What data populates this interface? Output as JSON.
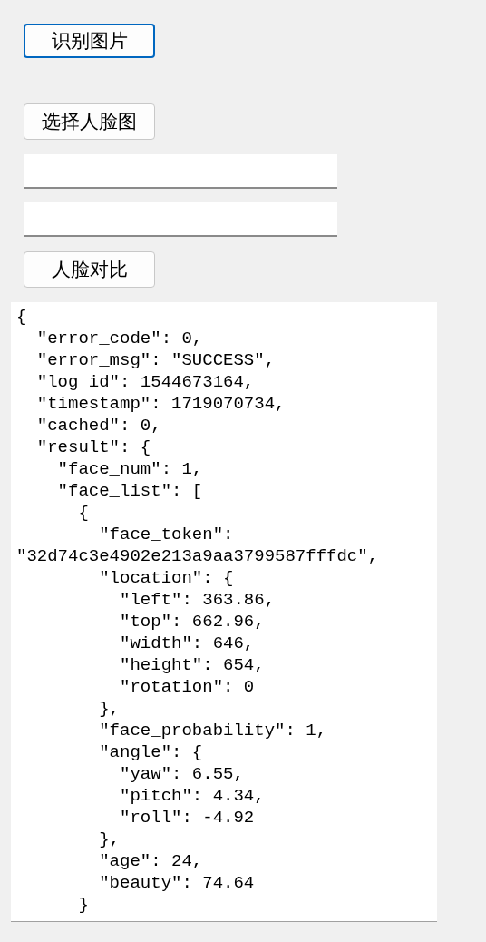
{
  "buttons_top": [
    {
      "label": "识别图片",
      "focused": true
    }
  ],
  "select_button": {
    "label": "选择人脸图",
    "focused": false
  },
  "text_fields": [
    {
      "focused": false
    },
    {
      "focused": false
    }
  ],
  "compare_button": {
    "label": "人脸对比",
    "focused": false
  },
  "output": {
    "text": "{\n  \"error_code\": 0,\n  \"error_msg\": \"SUCCESS\",\n  \"log_id\": 1544673164,\n  \"timestamp\": 1719070734,\n  \"cached\": 0,\n  \"result\": {\n    \"face_num\": 1,\n    \"face_list\": [\n      {\n        \"face_token\":\n\"32d74c3e4902e213a9aa3799587fffdc\",\n        \"location\": {\n          \"left\": 363.86,\n          \"top\": 662.96,\n          \"width\": 646,\n          \"height\": 654,\n          \"rotation\": 0\n        },\n        \"face_probability\": 1,\n        \"angle\": {\n          \"yaw\": 6.55,\n          \"pitch\": 4.34,\n          \"roll\": -4.92\n        },\n        \"age\": 24,\n        \"beauty\": 74.64\n      }"
  }
}
